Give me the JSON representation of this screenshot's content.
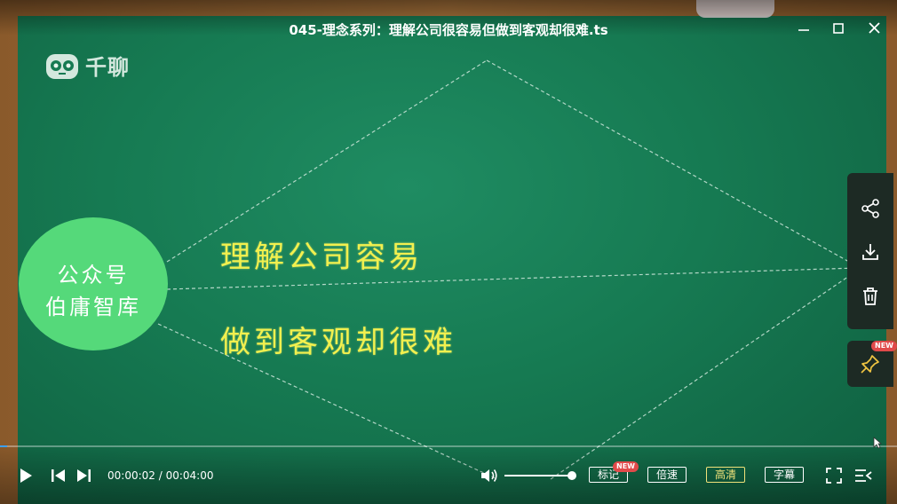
{
  "window": {
    "title": "045-理念系列：理解公司很容易但做到客观却很难.ts",
    "controls": [
      "minimize-icon",
      "maximize-icon",
      "close-icon"
    ]
  },
  "video_content": {
    "logo_text": "千聊",
    "circle_line1": "公众号",
    "circle_line2": "伯庸智库",
    "chalk_line1": "理解公司容易",
    "chalk_line2": "做到客观却很难"
  },
  "side_panel": {
    "buttons": [
      "share-icon",
      "download-icon",
      "delete-icon"
    ],
    "pin_badge": "NEW"
  },
  "player": {
    "progress_fraction": 0.008,
    "time_current": "00:00:02",
    "time_separator": " / ",
    "time_total": "00:04:00",
    "volume_fraction": 1.0,
    "mark_label": "标记",
    "mark_badge": "NEW",
    "speed_label": "倍速",
    "quality_label": "高清",
    "subtitle_label": "字幕"
  },
  "colors": {
    "board": "#167a52",
    "circle": "#55d97a",
    "chalk": "#f2f04e",
    "quality_active": "#f0e27a",
    "badge": "#e04a4a"
  }
}
